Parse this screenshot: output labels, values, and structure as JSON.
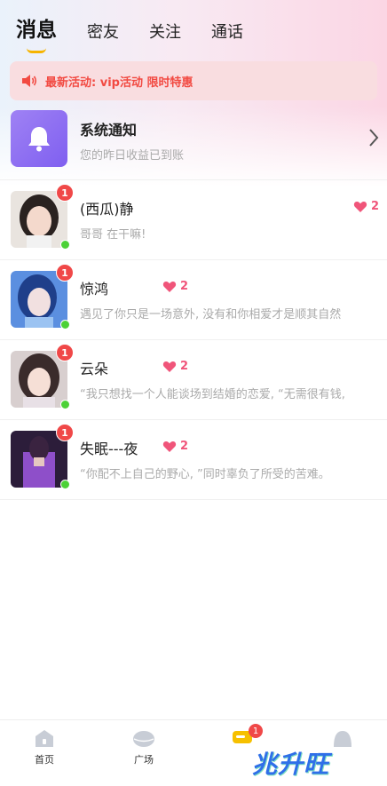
{
  "tabs": [
    {
      "label": "消息",
      "active": true
    },
    {
      "label": "密友",
      "active": false
    },
    {
      "label": "关注",
      "active": false
    },
    {
      "label": "通话",
      "active": false
    }
  ],
  "banner": {
    "text": "最新活动: vip活动 限时特惠",
    "icon": "speaker-icon",
    "color": "#f24a42"
  },
  "system": {
    "title": "系统通知",
    "subtitle": "您的昨日收益已到账",
    "icon": "bell-icon"
  },
  "conversations": [
    {
      "name": "(西瓜)静",
      "message": "哥哥 在干嘛!",
      "unread": "1",
      "intimacy": "2",
      "online": true
    },
    {
      "name": "惊鸿",
      "message": "遇见了你只是一场意外, 没有和你相爱才是顺其自然",
      "unread": "1",
      "intimacy": "2",
      "online": true
    },
    {
      "name": "云朵",
      "message": "“我只想找一个人能谈场到结婚的恋爱, “无需很有钱,",
      "unread": "1",
      "intimacy": "2",
      "online": true
    },
    {
      "name": "失眠---夜",
      "message": "“你配不上自己的野心, ”同时辜负了所受的苦难。",
      "unread": "1",
      "intimacy": "2",
      "online": true
    }
  ],
  "bottom_nav": [
    {
      "label": "首页",
      "icon": "home-icon"
    },
    {
      "label": "广场",
      "icon": "plaza-icon"
    },
    {
      "label": "",
      "icon": "message-icon",
      "badge": "1"
    },
    {
      "label": "",
      "icon": "profile-icon"
    }
  ],
  "watermark": "兆升旺",
  "colors": {
    "accent": "#f6b400",
    "badge": "#f04848",
    "online": "#4cd137",
    "heart": "#f0557a",
    "system_icon": "#8a6df2"
  }
}
